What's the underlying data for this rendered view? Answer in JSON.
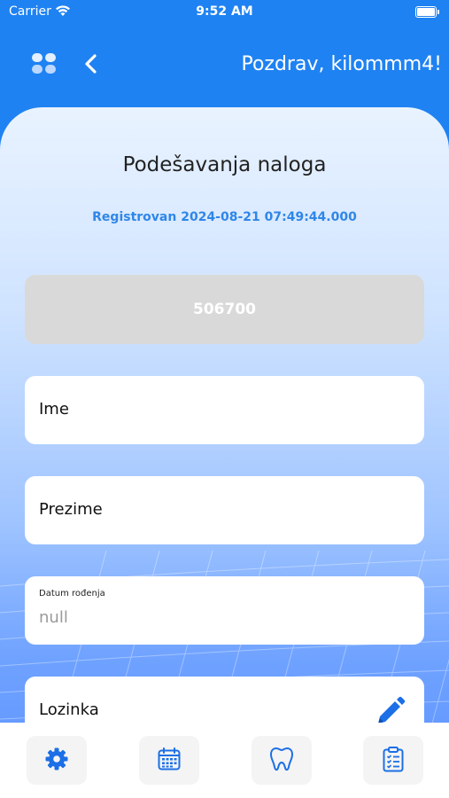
{
  "status_bar": {
    "carrier": "Carrier",
    "time": "9:52 AM"
  },
  "header": {
    "greeting": "Pozdrav, kilommm4!",
    "menu_icon": "grid-menu-icon",
    "back_icon": "chevron-left-icon"
  },
  "page": {
    "title": "Podešavanja naloga",
    "registered": "Registrovan 2024-08-21 07:49:44.000",
    "user_id": "506700"
  },
  "fields": {
    "first_name_label": "Ime",
    "last_name_label": "Prezime",
    "birthdate_label": "Datum rođenja",
    "birthdate_value": "null",
    "password_label": "Lozinka"
  },
  "bottom_nav": {
    "items": [
      {
        "icon": "gear-icon"
      },
      {
        "icon": "calendar-icon"
      },
      {
        "icon": "tooth-icon"
      },
      {
        "icon": "clipboard-checklist-icon"
      }
    ]
  },
  "colors": {
    "accent": "#1f82f2",
    "link_blue": "#2f86e8",
    "icon_blue": "#1c6fe6"
  }
}
